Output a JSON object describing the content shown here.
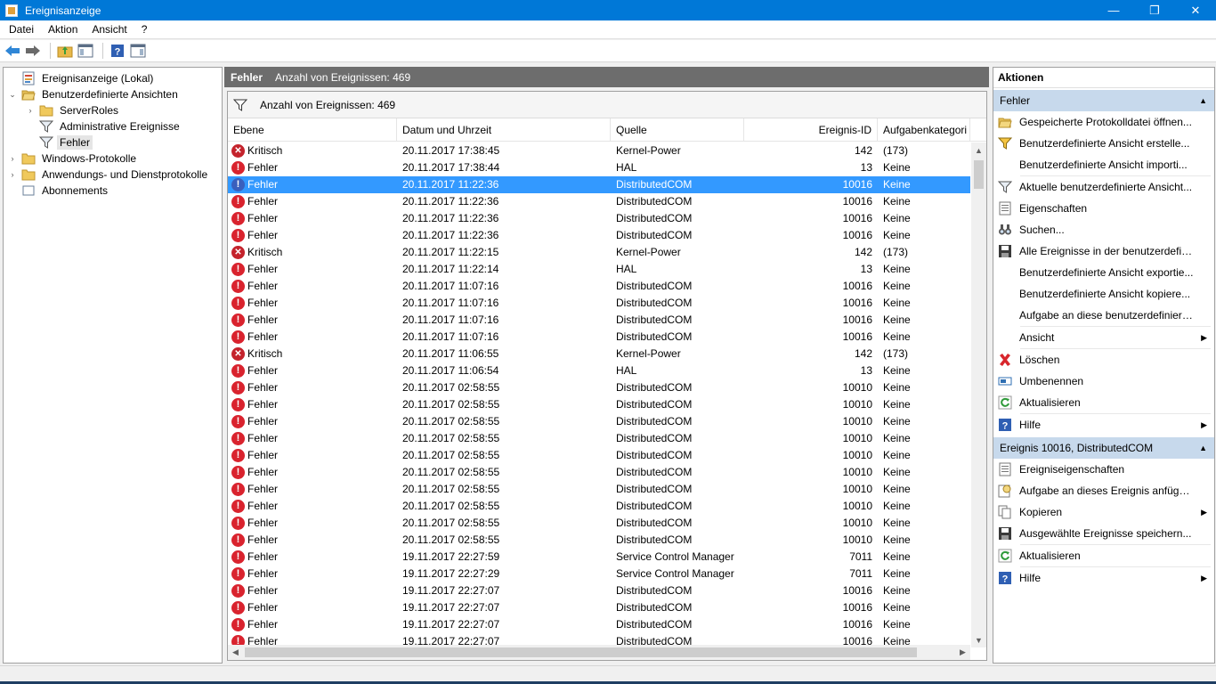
{
  "window": {
    "title": "Ereignisanzeige",
    "controls": {
      "minimize": "—",
      "maximize": "❐",
      "close": "✕"
    }
  },
  "menu": [
    "Datei",
    "Aktion",
    "Ansicht",
    "?"
  ],
  "toolbar": {
    "icons": [
      "back-arrow-icon",
      "forward-arrow-icon",
      "folder-up-icon",
      "show-hide-console-tree-icon",
      "help-icon",
      "show-hide-action-pane-icon"
    ]
  },
  "tree": {
    "items": [
      {
        "label": "Ereignisanzeige (Lokal)",
        "depth": 0,
        "twisty": "",
        "icon": "event-viewer-icon"
      },
      {
        "label": "Benutzerdefinierte Ansichten",
        "depth": 0,
        "twisty": "⌄",
        "icon": "folder-open-icon"
      },
      {
        "label": "ServerRoles",
        "depth": 1,
        "twisty": "›",
        "icon": "folder-icon"
      },
      {
        "label": "Administrative Ereignisse",
        "depth": 1,
        "twisty": "",
        "icon": "filter-icon"
      },
      {
        "label": "Fehler",
        "depth": 1,
        "twisty": "",
        "icon": "filter-icon",
        "selected": true
      },
      {
        "label": "Windows-Protokolle",
        "depth": 0,
        "twisty": "›",
        "icon": "folder-icon"
      },
      {
        "label": "Anwendungs- und Dienstprotokolle",
        "depth": 0,
        "twisty": "›",
        "icon": "folder-icon"
      },
      {
        "label": "Abonnements",
        "depth": 0,
        "twisty": "",
        "icon": "subscriptions-icon"
      }
    ]
  },
  "middle": {
    "header_name": "Fehler",
    "header_count": "Anzahl von Ereignissen: 469",
    "filter_text": "Anzahl von Ereignissen: 469",
    "columns": [
      "Ebene",
      "Datum und Uhrzeit",
      "Quelle",
      "Ereignis-ID",
      "Aufgabenkategori"
    ],
    "rows": [
      {
        "level": "Kritisch",
        "kind": "crit",
        "date": "20.11.2017 17:38:45",
        "source": "Kernel-Power",
        "id": "142",
        "task": "(173)"
      },
      {
        "level": "Fehler",
        "kind": "err",
        "date": "20.11.2017 17:38:44",
        "source": "HAL",
        "id": "13",
        "task": "Keine"
      },
      {
        "level": "Fehler",
        "kind": "err",
        "date": "20.11.2017 11:22:36",
        "source": "DistributedCOM",
        "id": "10016",
        "task": "Keine",
        "selected": true
      },
      {
        "level": "Fehler",
        "kind": "err",
        "date": "20.11.2017 11:22:36",
        "source": "DistributedCOM",
        "id": "10016",
        "task": "Keine"
      },
      {
        "level": "Fehler",
        "kind": "err",
        "date": "20.11.2017 11:22:36",
        "source": "DistributedCOM",
        "id": "10016",
        "task": "Keine"
      },
      {
        "level": "Fehler",
        "kind": "err",
        "date": "20.11.2017 11:22:36",
        "source": "DistributedCOM",
        "id": "10016",
        "task": "Keine"
      },
      {
        "level": "Kritisch",
        "kind": "crit",
        "date": "20.11.2017 11:22:15",
        "source": "Kernel-Power",
        "id": "142",
        "task": "(173)"
      },
      {
        "level": "Fehler",
        "kind": "err",
        "date": "20.11.2017 11:22:14",
        "source": "HAL",
        "id": "13",
        "task": "Keine"
      },
      {
        "level": "Fehler",
        "kind": "err",
        "date": "20.11.2017 11:07:16",
        "source": "DistributedCOM",
        "id": "10016",
        "task": "Keine"
      },
      {
        "level": "Fehler",
        "kind": "err",
        "date": "20.11.2017 11:07:16",
        "source": "DistributedCOM",
        "id": "10016",
        "task": "Keine"
      },
      {
        "level": "Fehler",
        "kind": "err",
        "date": "20.11.2017 11:07:16",
        "source": "DistributedCOM",
        "id": "10016",
        "task": "Keine"
      },
      {
        "level": "Fehler",
        "kind": "err",
        "date": "20.11.2017 11:07:16",
        "source": "DistributedCOM",
        "id": "10016",
        "task": "Keine"
      },
      {
        "level": "Kritisch",
        "kind": "crit",
        "date": "20.11.2017 11:06:55",
        "source": "Kernel-Power",
        "id": "142",
        "task": "(173)"
      },
      {
        "level": "Fehler",
        "kind": "err",
        "date": "20.11.2017 11:06:54",
        "source": "HAL",
        "id": "13",
        "task": "Keine"
      },
      {
        "level": "Fehler",
        "kind": "err",
        "date": "20.11.2017 02:58:55",
        "source": "DistributedCOM",
        "id": "10010",
        "task": "Keine"
      },
      {
        "level": "Fehler",
        "kind": "err",
        "date": "20.11.2017 02:58:55",
        "source": "DistributedCOM",
        "id": "10010",
        "task": "Keine"
      },
      {
        "level": "Fehler",
        "kind": "err",
        "date": "20.11.2017 02:58:55",
        "source": "DistributedCOM",
        "id": "10010",
        "task": "Keine"
      },
      {
        "level": "Fehler",
        "kind": "err",
        "date": "20.11.2017 02:58:55",
        "source": "DistributedCOM",
        "id": "10010",
        "task": "Keine"
      },
      {
        "level": "Fehler",
        "kind": "err",
        "date": "20.11.2017 02:58:55",
        "source": "DistributedCOM",
        "id": "10010",
        "task": "Keine"
      },
      {
        "level": "Fehler",
        "kind": "err",
        "date": "20.11.2017 02:58:55",
        "source": "DistributedCOM",
        "id": "10010",
        "task": "Keine"
      },
      {
        "level": "Fehler",
        "kind": "err",
        "date": "20.11.2017 02:58:55",
        "source": "DistributedCOM",
        "id": "10010",
        "task": "Keine"
      },
      {
        "level": "Fehler",
        "kind": "err",
        "date": "20.11.2017 02:58:55",
        "source": "DistributedCOM",
        "id": "10010",
        "task": "Keine"
      },
      {
        "level": "Fehler",
        "kind": "err",
        "date": "20.11.2017 02:58:55",
        "source": "DistributedCOM",
        "id": "10010",
        "task": "Keine"
      },
      {
        "level": "Fehler",
        "kind": "err",
        "date": "20.11.2017 02:58:55",
        "source": "DistributedCOM",
        "id": "10010",
        "task": "Keine"
      },
      {
        "level": "Fehler",
        "kind": "err",
        "date": "19.11.2017 22:27:59",
        "source": "Service Control Manager",
        "id": "7011",
        "task": "Keine"
      },
      {
        "level": "Fehler",
        "kind": "err",
        "date": "19.11.2017 22:27:29",
        "source": "Service Control Manager",
        "id": "7011",
        "task": "Keine"
      },
      {
        "level": "Fehler",
        "kind": "err",
        "date": "19.11.2017 22:27:07",
        "source": "DistributedCOM",
        "id": "10016",
        "task": "Keine"
      },
      {
        "level": "Fehler",
        "kind": "err",
        "date": "19.11.2017 22:27:07",
        "source": "DistributedCOM",
        "id": "10016",
        "task": "Keine"
      },
      {
        "level": "Fehler",
        "kind": "err",
        "date": "19.11.2017 22:27:07",
        "source": "DistributedCOM",
        "id": "10016",
        "task": "Keine"
      },
      {
        "level": "Fehler",
        "kind": "err",
        "date": "19.11.2017 22:27:07",
        "source": "DistributedCOM",
        "id": "10016",
        "task": "Keine"
      }
    ]
  },
  "actions": {
    "title": "Aktionen",
    "sections": [
      {
        "header": "Fehler",
        "items": [
          {
            "label": "Gespeicherte Protokolldatei öffnen...",
            "icon": "open-log-icon"
          },
          {
            "label": "Benutzerdefinierte Ansicht erstelle...",
            "icon": "create-filter-icon"
          },
          {
            "label": "Benutzerdefinierte Ansicht importi...",
            "icon": ""
          },
          {
            "label": "Aktuelle benutzerdefinierte Ansicht...",
            "icon": "filter-icon",
            "sep_before": true
          },
          {
            "label": "Eigenschaften",
            "icon": "properties-icon"
          },
          {
            "label": "Suchen...",
            "icon": "binoculars-icon"
          },
          {
            "label": "Alle Ereignisse in der benutzerdefin...",
            "icon": "save-icon"
          },
          {
            "label": "Benutzerdefinierte Ansicht exportie...",
            "icon": ""
          },
          {
            "label": "Benutzerdefinierte Ansicht kopiere...",
            "icon": ""
          },
          {
            "label": "Aufgabe an diese benutzerdefiniert...",
            "icon": ""
          },
          {
            "label": "Ansicht",
            "icon": "",
            "submenu": true,
            "sep_before": true
          },
          {
            "label": "Löschen",
            "icon": "delete-icon",
            "sep_before": true
          },
          {
            "label": "Umbenennen",
            "icon": "rename-icon"
          },
          {
            "label": "Aktualisieren",
            "icon": "refresh-icon"
          },
          {
            "label": "Hilfe",
            "icon": "help-icon",
            "submenu": true,
            "sep_before": true
          }
        ]
      },
      {
        "header": "Ereignis 10016, DistributedCOM",
        "items": [
          {
            "label": "Ereigniseigenschaften",
            "icon": "event-properties-icon"
          },
          {
            "label": "Aufgabe an dieses Ereignis anfüge...",
            "icon": "attach-task-icon"
          },
          {
            "label": "Kopieren",
            "icon": "copy-icon",
            "submenu": true
          },
          {
            "label": "Ausgewählte Ereignisse speichern...",
            "icon": "save-icon"
          },
          {
            "label": "Aktualisieren",
            "icon": "refresh-icon",
            "sep_before": true
          },
          {
            "label": "Hilfe",
            "icon": "help-icon",
            "submenu": true,
            "sep_before": true
          }
        ]
      }
    ]
  },
  "colors": {
    "titlebar": "#0078d7",
    "selection": "#3399ff",
    "error_icon": "#d9232e",
    "section_header": "#c7d9ec",
    "pane_header": "#6d6d6d"
  }
}
